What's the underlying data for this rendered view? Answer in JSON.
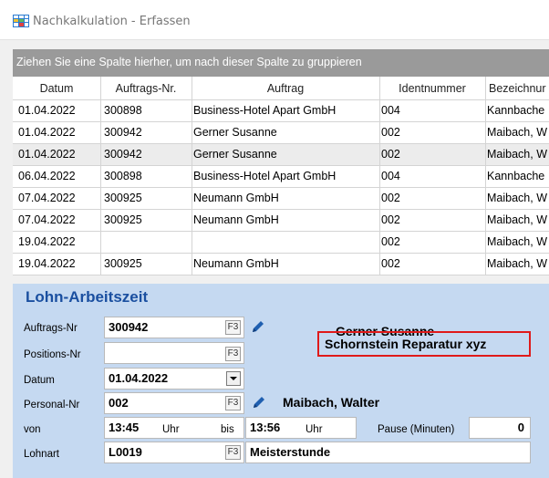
{
  "window": {
    "title": "Nachkalkulation - Erfassen"
  },
  "group_panel": {
    "text": "Ziehen Sie eine Spalte hierher, um nach dieser Spalte zu gruppieren"
  },
  "grid": {
    "columns": [
      "Datum",
      "Auftrags-Nr.",
      "Auftrag",
      "Identnummer",
      "Bezeichnur"
    ],
    "rows": [
      [
        "01.04.2022",
        "300898",
        "Business-Hotel Apart GmbH",
        "004",
        "Kannbache"
      ],
      [
        "01.04.2022",
        "300942",
        "Gerner Susanne",
        "002",
        "Maibach, W"
      ],
      [
        "01.04.2022",
        "300942",
        "Gerner Susanne",
        "002",
        "Maibach, W"
      ],
      [
        "06.04.2022",
        "300898",
        "Business-Hotel Apart GmbH",
        "004",
        "Kannbache"
      ],
      [
        "07.04.2022",
        "300925",
        "Neumann GmbH",
        "002",
        "Maibach, W"
      ],
      [
        "07.04.2022",
        "300925",
        "Neumann GmbH",
        "002",
        "Maibach, W"
      ],
      [
        "19.04.2022",
        "",
        "",
        "002",
        "Maibach, W"
      ],
      [
        "19.04.2022",
        "300925",
        "Neumann GmbH",
        "002",
        "Maibach, W"
      ]
    ],
    "selected_row": 2
  },
  "form": {
    "section_title": "Lohn-Arbeitszeit",
    "labels": {
      "auftrags_nr": "Auftrags-Nr",
      "positions_nr": "Positions-Nr",
      "datum": "Datum",
      "personal_nr": "Personal-Nr",
      "von": "von",
      "lohnart": "Lohnart",
      "uhr1": "Uhr",
      "bis": "bis",
      "uhr2": "Uhr",
      "pause": "Pause (Minuten)"
    },
    "values": {
      "auftrags_nr": "300942",
      "positions_nr": "",
      "datum": "01.04.2022",
      "personal_nr": "002",
      "von": "13:45",
      "bis": "13:56",
      "pause": "0",
      "lohnart": "L0019"
    },
    "f3_label": "F3",
    "customer_name": "Gerner Susanne",
    "order_description": "Schornstein Reparatur xyz",
    "employee_name": "Maibach, Walter",
    "lohnart_name": "Meisterstunde"
  },
  "colors": {
    "form_background": "#c5d9f1",
    "section_title": "#1a4fa0",
    "highlight_border": "#e01a1a",
    "group_panel": "#9a9a9a"
  }
}
